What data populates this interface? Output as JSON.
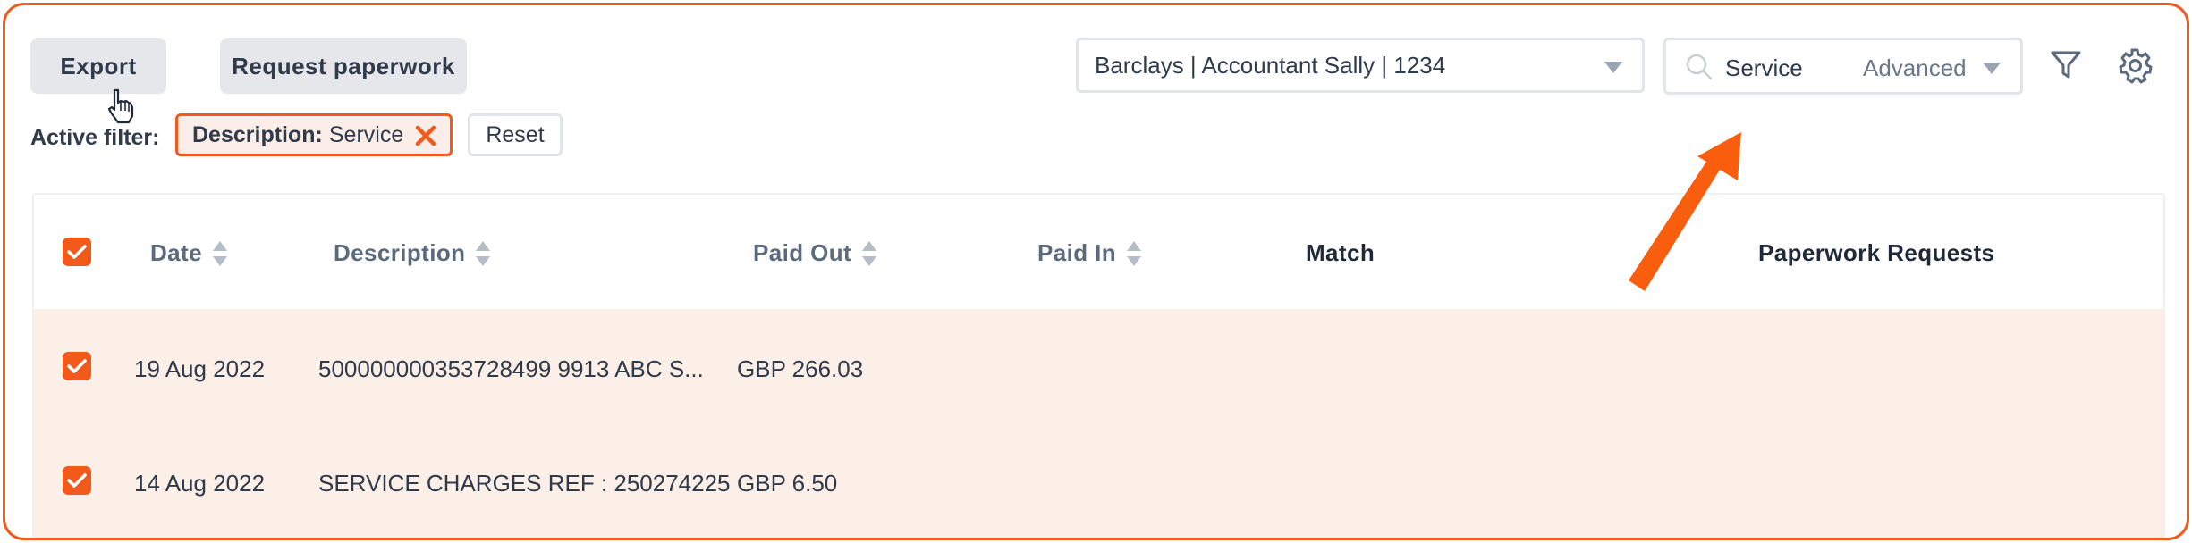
{
  "toolbar": {
    "export_label": "Export",
    "request_label": "Request paperwork"
  },
  "account_select": {
    "value": "Barclays | Accountant Sally | 1234"
  },
  "search": {
    "value": "Service",
    "advanced_label": "Advanced"
  },
  "filters": {
    "active_label": "Active filter:",
    "chip_key": "Description:",
    "chip_value": "Service",
    "reset_label": "Reset"
  },
  "table": {
    "columns": {
      "date": "Date",
      "description": "Description",
      "paid_out": "Paid Out",
      "paid_in": "Paid In",
      "match": "Match",
      "paperwork": "Paperwork Requests"
    },
    "rows": [
      {
        "date": "19 Aug 2022",
        "description": "500000000353728499 9913 ABC S...",
        "paid_out": "GBP 266.03",
        "paid_in": ""
      },
      {
        "date": "14 Aug 2022",
        "description": "SERVICE CHARGES REF : 250274225",
        "paid_out": "GBP 6.50",
        "paid_in": ""
      }
    ]
  },
  "colors": {
    "accent": "#f25a1c",
    "row_highlight": "#fcefe8",
    "button_bg": "#e5e7eb",
    "text": "#2f3a4b"
  },
  "icons": [
    "pointer-cursor-icon",
    "chevron-down-icon",
    "search-icon",
    "filter-icon",
    "gear-icon",
    "close-icon",
    "checkbox-checked-icon",
    "sort-icon",
    "annotation-arrow-icon"
  ]
}
